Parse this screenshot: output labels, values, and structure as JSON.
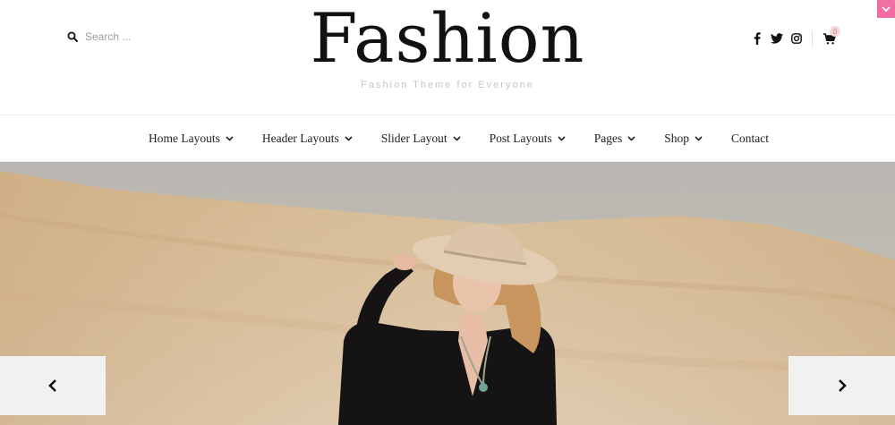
{
  "header": {
    "search": {
      "placeholder": "Search ..."
    },
    "logo": "Fashion",
    "tagline": "Fashion Theme for Everyone",
    "social": [
      "facebook-icon",
      "twitter-icon",
      "instagram-icon"
    ],
    "cart": {
      "icon": "cart-icon",
      "count": "0"
    },
    "accent": "#f06ea1"
  },
  "nav": {
    "items": [
      {
        "label": "Home Layouts",
        "dropdown": true
      },
      {
        "label": "Header Layouts",
        "dropdown": true
      },
      {
        "label": "Slider Layout",
        "dropdown": true
      },
      {
        "label": "Post Layouts",
        "dropdown": true
      },
      {
        "label": "Pages",
        "dropdown": true
      },
      {
        "label": "Shop",
        "dropdown": true
      },
      {
        "label": "Contact",
        "dropdown": false
      }
    ]
  },
  "slider": {
    "prev_icon": "chevron-left-icon",
    "next_icon": "chevron-right-icon"
  }
}
